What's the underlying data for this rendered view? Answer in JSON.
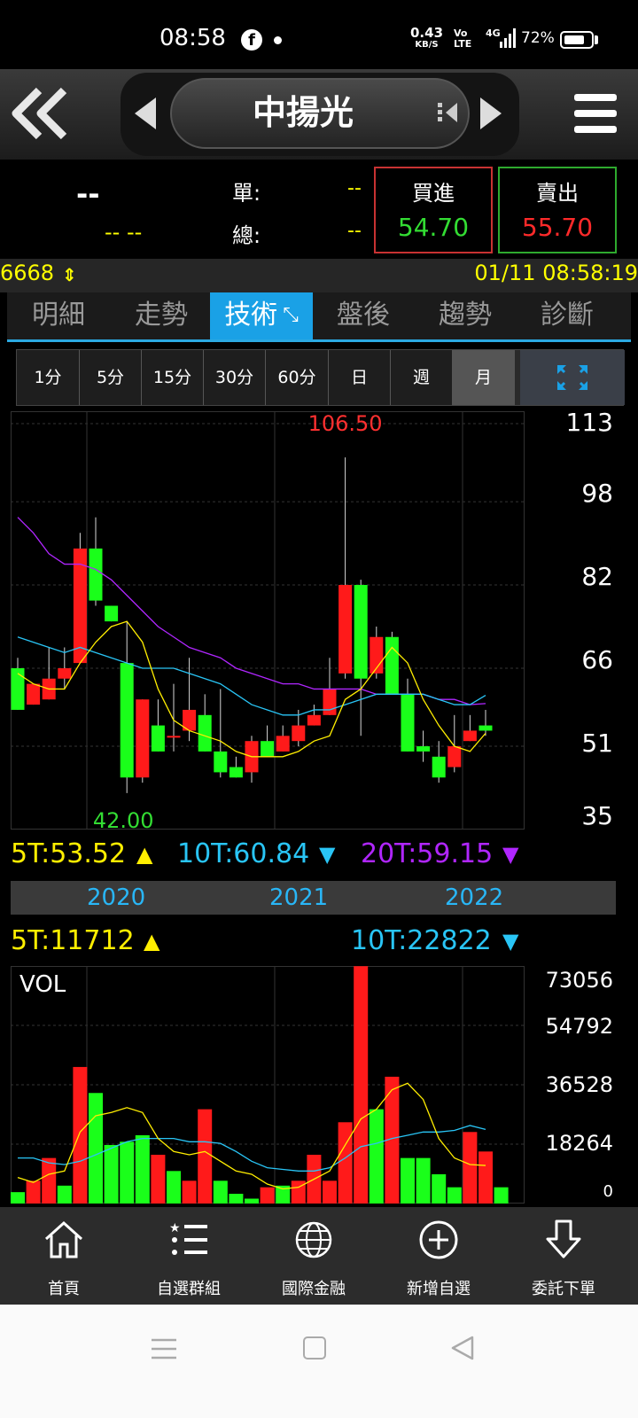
{
  "status_bar": {
    "time": "08:58",
    "net_speed_value": "0.43",
    "net_speed_unit": "KB/S",
    "volte_top": "Vo",
    "volte_bottom": "LTE",
    "network": "4G",
    "battery": "72%",
    "battery_level": 0.72,
    "icons": [
      "facebook-icon",
      "notification-dot-icon",
      "signal-icon",
      "battery-icon"
    ]
  },
  "header": {
    "stock_name": "中揚光",
    "icons": [
      "back-double-chevron-icon",
      "prev-arrow-icon",
      "swap-icon",
      "next-arrow-icon",
      "hamburger-menu-icon"
    ]
  },
  "quote": {
    "price": "--",
    "change": "-- --",
    "single_label": "單:",
    "single_value": "--",
    "total_label": "總:",
    "total_value": "--",
    "buy_label": "買進",
    "buy_price": "54.70",
    "sell_label": "賣出",
    "sell_price": "55.70"
  },
  "info_bar": {
    "volume": "6668",
    "datetime": "01/11 08:58:19"
  },
  "tabs": [
    {
      "label": "明細",
      "active": false
    },
    {
      "label": "走勢",
      "active": false
    },
    {
      "label": "技術",
      "active": true
    },
    {
      "label": "盤後",
      "active": false
    },
    {
      "label": "趨勢",
      "active": false
    },
    {
      "label": "診斷",
      "active": false
    }
  ],
  "periods": [
    {
      "label": "1分",
      "active": false
    },
    {
      "label": "5分",
      "active": false
    },
    {
      "label": "15分",
      "active": false
    },
    {
      "label": "30分",
      "active": false
    },
    {
      "label": "60分",
      "active": false
    },
    {
      "label": "日",
      "active": false
    },
    {
      "label": "週",
      "active": false
    },
    {
      "label": "月",
      "active": true
    }
  ],
  "colors": {
    "up": "#ff1a1a",
    "down": "#1aff1a",
    "ma5": "#ffee00",
    "ma10": "#29c5f6",
    "ma20": "#b026ff",
    "accent": "#1aa1e6",
    "buy_border": "#c83232",
    "sell_border": "#2eaa2e"
  },
  "chart_data": [
    {
      "type": "candlestick",
      "period": "month",
      "max_label": "106.50",
      "min_label": "42.00",
      "y_ticks": [
        "113",
        "98",
        "82",
        "66",
        "51",
        "35"
      ],
      "ylim": [
        35,
        113
      ],
      "x_year_labels": [
        "2020",
        "2021",
        "2022"
      ],
      "ma_labels": [
        {
          "name": "5T",
          "value": "53.52",
          "text": "5T:53.52"
        },
        {
          "name": "10T",
          "value": "60.84",
          "text": "10T:60.84"
        },
        {
          "name": "20T",
          "value": "59.15",
          "text": "20T:59.15"
        }
      ],
      "candles": [
        {
          "o": 66,
          "h": 68,
          "l": 58,
          "c": 58
        },
        {
          "o": 59,
          "h": 63,
          "l": 59,
          "c": 63
        },
        {
          "o": 60,
          "h": 70,
          "l": 60,
          "c": 64
        },
        {
          "o": 64,
          "h": 70,
          "l": 62,
          "c": 66
        },
        {
          "o": 67,
          "h": 92,
          "l": 67,
          "c": 89
        },
        {
          "o": 89,
          "h": 95,
          "l": 78,
          "c": 79
        },
        {
          "o": 78,
          "h": 78,
          "l": 75,
          "c": 75
        },
        {
          "o": 67,
          "h": 75,
          "l": 42,
          "c": 45
        },
        {
          "o": 45,
          "h": 60,
          "l": 44,
          "c": 60
        },
        {
          "o": 55,
          "h": 60,
          "l": 50,
          "c": 50
        },
        {
          "o": 53,
          "h": 63,
          "l": 50,
          "c": 53
        },
        {
          "o": 54,
          "h": 68,
          "l": 52,
          "c": 58
        },
        {
          "o": 57,
          "h": 61,
          "l": 50,
          "c": 50
        },
        {
          "o": 50,
          "h": 62,
          "l": 45,
          "c": 46
        },
        {
          "o": 47,
          "h": 49,
          "l": 45,
          "c": 45
        },
        {
          "o": 46,
          "h": 53,
          "l": 44,
          "c": 52
        },
        {
          "o": 52,
          "h": 55,
          "l": 49,
          "c": 49
        },
        {
          "o": 50,
          "h": 55,
          "l": 50,
          "c": 53
        },
        {
          "o": 52,
          "h": 58,
          "l": 51,
          "c": 55
        },
        {
          "o": 55,
          "h": 59,
          "l": 55,
          "c": 57
        },
        {
          "o": 57,
          "h": 68,
          "l": 57,
          "c": 62
        },
        {
          "o": 65,
          "h": 106.5,
          "l": 64,
          "c": 82
        },
        {
          "o": 82,
          "h": 83,
          "l": 53,
          "c": 64
        },
        {
          "o": 65,
          "h": 74,
          "l": 64,
          "c": 72
        },
        {
          "o": 72,
          "h": 73,
          "l": 62,
          "c": 61
        },
        {
          "o": 61,
          "h": 64,
          "l": 50,
          "c": 50
        },
        {
          "o": 51,
          "h": 54,
          "l": 48,
          "c": 50
        },
        {
          "o": 49,
          "h": 52,
          "l": 44,
          "c": 45
        },
        {
          "o": 47,
          "h": 57,
          "l": 46,
          "c": 51
        },
        {
          "o": 52,
          "h": 57,
          "l": 52,
          "c": 54
        },
        {
          "o": 55,
          "h": 58,
          "l": 53,
          "c": 54
        }
      ],
      "ma5": [
        65,
        63,
        62,
        62,
        67,
        71,
        74,
        75,
        71,
        62,
        56,
        54,
        53,
        52,
        50,
        49,
        49,
        49,
        50,
        52,
        53,
        60,
        62,
        66,
        70,
        67,
        60,
        55,
        51,
        50,
        53.5
      ],
      "ma10": [
        72,
        71,
        70,
        69,
        70,
        69,
        68,
        67,
        66,
        66,
        66,
        65,
        64,
        63,
        61,
        59,
        58,
        57,
        57,
        58,
        58,
        59,
        60,
        61,
        61,
        61,
        61,
        60,
        59,
        59,
        60.8
      ],
      "ma20": [
        95,
        92,
        88,
        86,
        86,
        85,
        83,
        80,
        77,
        74,
        72,
        70,
        69,
        68,
        66,
        65,
        64,
        63,
        63,
        62,
        62,
        62,
        62,
        61,
        61,
        61,
        61,
        60,
        60,
        59,
        59.2
      ]
    },
    {
      "type": "bar",
      "title": "VOL",
      "y_ticks": [
        "73056",
        "54792",
        "36528",
        "18264",
        "0"
      ],
      "ylim": [
        0,
        73056
      ],
      "ma_labels": [
        {
          "name": "5T",
          "value": "11712",
          "text": "5T:11712"
        },
        {
          "name": "10T",
          "value": "22822",
          "text": "10T:22822"
        }
      ],
      "values": [
        3500,
        7000,
        14000,
        5500,
        42000,
        34000,
        18000,
        19000,
        21000,
        15000,
        10000,
        7000,
        29000,
        7000,
        3000,
        1500,
        5000,
        5500,
        7000,
        15000,
        7000,
        25000,
        73000,
        29000,
        39000,
        14000,
        14000,
        9000,
        5000,
        22000,
        16000,
        5000
      ],
      "up": [
        false,
        true,
        true,
        false,
        true,
        false,
        false,
        false,
        false,
        true,
        false,
        true,
        true,
        false,
        false,
        false,
        true,
        false,
        true,
        true,
        true,
        true,
        true,
        false,
        true,
        false,
        false,
        false,
        false,
        true,
        true,
        false
      ],
      "ma5": [
        8000,
        6500,
        9000,
        10000,
        22000,
        27000,
        28000,
        29500,
        28000,
        20000,
        16000,
        15000,
        16000,
        13000,
        10000,
        9000,
        6000,
        4500,
        5000,
        7500,
        10000,
        18000,
        26000,
        29000,
        35000,
        37000,
        32000,
        20000,
        14000,
        12000,
        11700
      ],
      "ma10": [
        14000,
        14000,
        12500,
        12000,
        13000,
        15000,
        17000,
        19000,
        20000,
        20000,
        20000,
        19000,
        19000,
        18500,
        16000,
        13000,
        11000,
        10500,
        10000,
        10000,
        11000,
        14000,
        17500,
        18500,
        20000,
        21000,
        22000,
        22000,
        22500,
        24000,
        22800
      ]
    }
  ],
  "bottom_nav": [
    {
      "label": "首頁",
      "icon": "home-icon"
    },
    {
      "label": "自選群組",
      "icon": "list-icon"
    },
    {
      "label": "國際金融",
      "icon": "globe-icon"
    },
    {
      "label": "新增自選",
      "icon": "add-circle-icon"
    },
    {
      "label": "委託下單",
      "icon": "order-arrow-icon"
    }
  ],
  "system_nav": [
    "recent-apps-icon",
    "home-square-icon",
    "back-triangle-icon"
  ]
}
